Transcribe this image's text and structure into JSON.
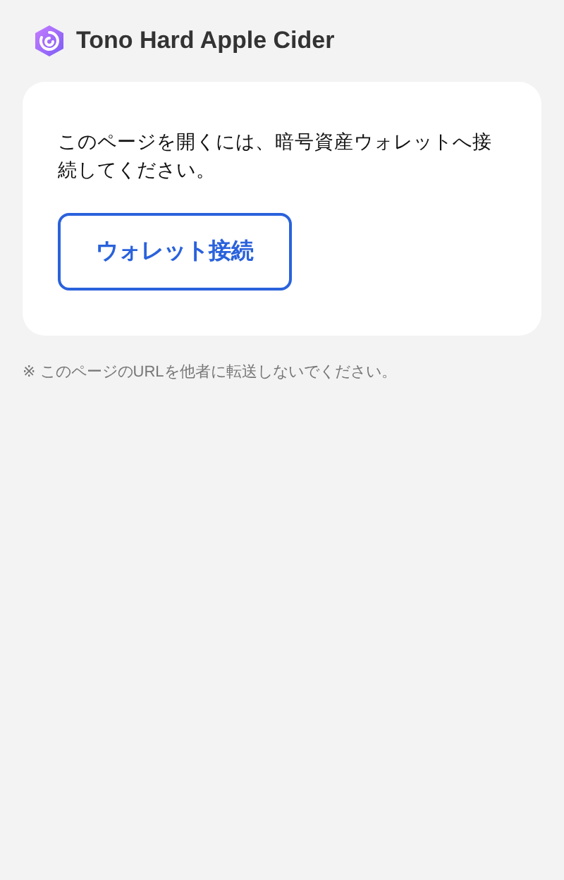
{
  "header": {
    "title": "Tono Hard Apple Cider"
  },
  "card": {
    "message": "このページを開くには、暗号資産ウォレットへ接続してください。",
    "button": "ウォレット接続"
  },
  "note": "※ このページのURLを他者に転送しないでください。"
}
